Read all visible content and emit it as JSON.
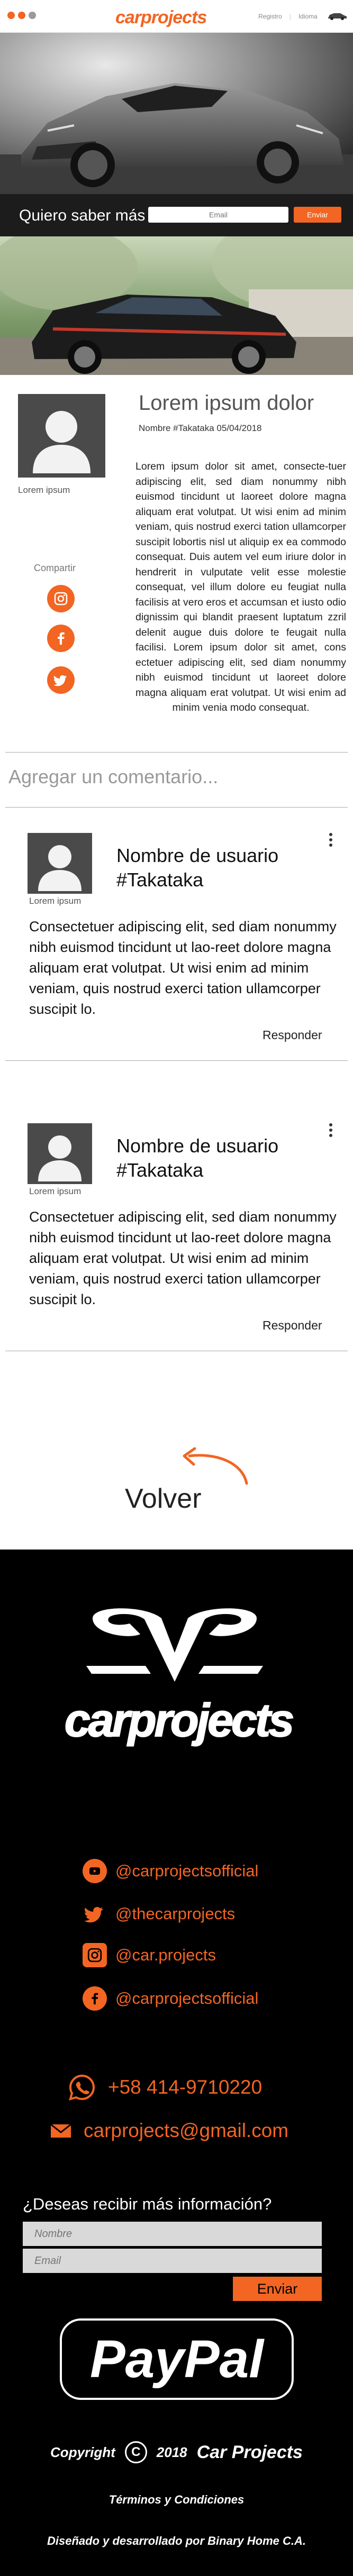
{
  "header": {
    "brand": "carprojects",
    "links": [
      "Registro",
      "Idioma"
    ]
  },
  "subscribe": {
    "question": "Quiero saber más",
    "email_placeholder": "Email",
    "button": "Enviar"
  },
  "article": {
    "avatar_caption": "Lorem ipsum",
    "title": "Lorem ipsum dolor",
    "meta": "Nombre #Takataka 05/04/2018",
    "body": "Lorem ipsum dolor sit amet, consecte-tuer adipiscing elit, sed diam nonummy nibh euismod tincidunt ut laoreet dolore magna aliquam erat volutpat. Ut wisi enim ad minim veniam, quis nostrud exerci tation ullamcorper suscipit lobortis nisl ut aliquip ex ea commodo consequat. Duis autem vel eum iriure dolor in hendrerit in vulputate velit esse molestie consequat, vel illum dolore eu feugiat nulla facilisis at vero eros et accumsan et iusto odio dignissim qui blandit praesent luptatum zzril delenit augue duis dolore te feugait nulla facilisi. Lorem ipsum dolor sit amet, cons ectetuer adipiscing elit, sed diam nonummy nibh euismod tincidunt ut laoreet dolore magna aliquam erat volutpat. Ut wisi enim ad minim venia modo consequat.",
    "share_label": "Compartir"
  },
  "add_comment": "Agregar un comentario...",
  "comments": [
    {
      "avatar_caption": "Lorem ipsum",
      "user": "Nombre de usuario",
      "handle": "#Takataka",
      "body": "Consectetuer adipiscing elit, sed diam nonummy nibh euismod tincidunt ut lao-reet dolore magna aliquam erat volutpat. Ut wisi enim ad minim veniam, quis nostrud exerci tation ullamcorper suscipit lo.",
      "reply": "Responder"
    },
    {
      "avatar_caption": "Lorem ipsum",
      "user": "Nombre de usuario",
      "handle": "#Takataka",
      "body": "Consectetuer adipiscing elit, sed diam nonummy nibh euismod tincidunt ut lao-reet dolore magna aliquam erat volutpat. Ut wisi enim ad minim veniam, quis nostrud exerci tation ullamcorper suscipit lo.",
      "reply": "Responder"
    }
  ],
  "back": "Volver",
  "footer": {
    "brand": "carprojects",
    "youtube": "@carprojectsofficial",
    "twitter": "@thecarprojects",
    "instagram": "@car.projects",
    "facebook": "@carprojectsofficial",
    "phone": "+58 414-9710220",
    "email": "carprojects@gmail.com",
    "question": "¿Deseas recibir más información?",
    "name_placeholder": "Nombre",
    "email_placeholder": "Email",
    "send": "Enviar",
    "paypal": "PayPal",
    "copyright_label": "Copyright",
    "copyright_symbol": "C",
    "year": "2018",
    "company": "Car Projects",
    "terms": "Términos y Condiciones",
    "credits": "Diseñado y desarrollado por Binary Home C.A."
  },
  "colors": {
    "accent": "#f26522",
    "footer_bg": "#000000",
    "subbar_bg": "#1c1c1c"
  }
}
